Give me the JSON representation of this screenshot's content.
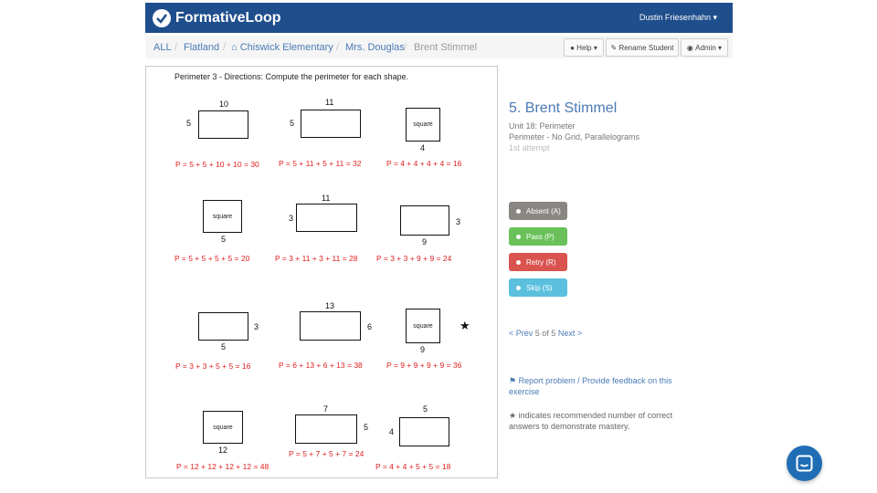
{
  "header": {
    "brand": "FormativeLoop",
    "user": "Dustin Friesenhahn"
  },
  "breadcrumb": {
    "items": [
      "ALL",
      "Flatland",
      "Chiswick Elementary",
      "Mrs. Douglas",
      "Brent Stimmel"
    ],
    "separator": "/"
  },
  "toolbar": {
    "help": "Help",
    "rename": "Rename Student",
    "admin": "Admin"
  },
  "worksheet": {
    "title": "Perimeter 3 - Directions: Compute the perimeter for each shape.",
    "square_label": "square",
    "problems": [
      {
        "dims": [
          "10",
          "5"
        ],
        "answer": "P = 5 + 5 + 10 + 10 = 30"
      },
      {
        "dims": [
          "11",
          "5"
        ],
        "answer": "P = 5 + 11 + 5 + 11 = 32"
      },
      {
        "dims": [
          "4"
        ],
        "answer": "P = 4 + 4 + 4 + 4 = 16"
      },
      {
        "dims": [
          "5"
        ],
        "answer": "P = 5 + 5 + 5 + 5 = 20"
      },
      {
        "dims": [
          "11",
          "3"
        ],
        "answer": "P = 3 + 11 + 3 + 11 = 28"
      },
      {
        "dims": [
          "3",
          "9"
        ],
        "answer": "P = 3 + 3 + 9 + 9 = 24"
      },
      {
        "dims": [
          "3",
          "5"
        ],
        "answer": "P = 3 + 3 + 5 + 5 = 16"
      },
      {
        "dims": [
          "13",
          "6"
        ],
        "answer": "P = 6 + 13 + 6 + 13 = 38"
      },
      {
        "dims": [
          "9"
        ],
        "answer": "P = 9 + 9 + 9 + 9 = 36"
      },
      {
        "dims": [
          "12"
        ],
        "answer": "P = 12 + 12 + 12 + 12 = 48"
      },
      {
        "dims": [
          "7",
          "5"
        ],
        "answer": "P = 5 + 7 + 5 + 7 = 24"
      },
      {
        "dims": [
          "5",
          "4"
        ],
        "answer": "P = 4 + 4 + 5 + 5 = 18"
      }
    ],
    "star": "★"
  },
  "student": {
    "name": "5. Brent Stimmel",
    "unit": "Unit 18: Perimeter",
    "exercise": "Perimeter - No Grid, Parallelograms",
    "attempt": "1st attempt"
  },
  "actions": [
    {
      "label": "Absent (A)",
      "color": "#8a8682"
    },
    {
      "label": "Pass (P)",
      "color": "#6ac15a"
    },
    {
      "label": "Retry (R)",
      "color": "#d9534f"
    },
    {
      "label": "Skip (S)",
      "color": "#5bc0de"
    }
  ],
  "pager": {
    "prev": "< Prev",
    "status": "5 of 5",
    "next": "Next >"
  },
  "report": "Report problem / Provide feedback on this exercise",
  "note": "★ indicates recommended number of correct answers to demonstrate mastery.",
  "colors": {
    "navbar": "#1f4e8c",
    "link": "#4a7ab5",
    "answer": "#e02020",
    "chat": "#1f6db5"
  }
}
